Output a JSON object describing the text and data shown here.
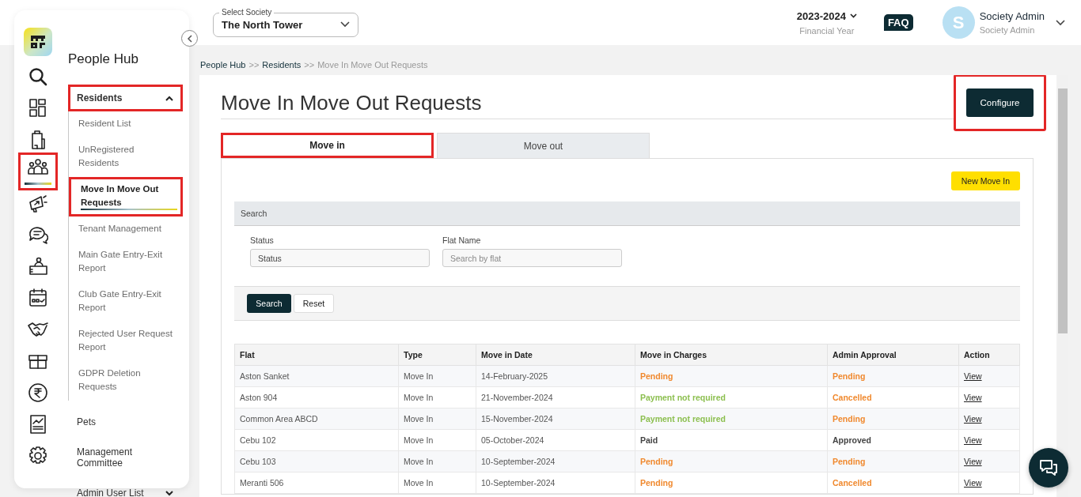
{
  "sidebar": {
    "rail": [
      {
        "kind": "search",
        "selected": false,
        "highlighted": false
      },
      {
        "kind": "dashboard",
        "selected": false,
        "highlighted": false
      },
      {
        "kind": "building",
        "selected": false,
        "highlighted": false
      },
      {
        "kind": "people",
        "selected": true,
        "highlighted": true
      },
      {
        "kind": "megaphone",
        "selected": false,
        "highlighted": false
      },
      {
        "kind": "chat",
        "selected": false,
        "highlighted": false
      },
      {
        "kind": "reception",
        "selected": false,
        "highlighted": false
      },
      {
        "kind": "calendar",
        "selected": false,
        "highlighted": false
      },
      {
        "kind": "handshake",
        "selected": false,
        "highlighted": false
      },
      {
        "kind": "gift",
        "selected": false,
        "highlighted": false
      },
      {
        "kind": "rupee",
        "selected": false,
        "highlighted": false
      },
      {
        "kind": "chart",
        "selected": false,
        "highlighted": false
      },
      {
        "kind": "settings",
        "selected": false,
        "highlighted": false
      }
    ],
    "nav": {
      "title": "People Hub",
      "groups": [
        {
          "label": "Residents",
          "expanded": true,
          "highlighted": true,
          "children": [
            {
              "label": "Resident List",
              "selected": false,
              "highlighted": false
            },
            {
              "label": "UnRegistered Residents",
              "selected": false,
              "highlighted": false
            },
            {
              "label": "Move In Move Out Requests",
              "selected": true,
              "highlighted": true
            },
            {
              "label": "Tenant Management",
              "selected": false,
              "highlighted": false
            },
            {
              "label": "Main Gate Entry-Exit Report",
              "selected": false,
              "highlighted": false
            },
            {
              "label": "Club Gate Entry-Exit Report",
              "selected": false,
              "highlighted": false
            },
            {
              "label": "Rejected User Request Report",
              "selected": false,
              "highlighted": false
            },
            {
              "label": "GDPR Deletion Requests",
              "selected": false,
              "highlighted": false
            }
          ]
        },
        {
          "label": "Pets",
          "highlighted": false
        },
        {
          "label": "Management Committee",
          "highlighted": false
        },
        {
          "label": "Admin User List",
          "expanded": false,
          "highlighted": false
        }
      ]
    }
  },
  "header": {
    "society": {
      "label": "Select Society",
      "value": "The North Tower"
    },
    "year": {
      "value": "2023-2024",
      "caption": "Financial Year"
    },
    "faq": "FAQ",
    "user": {
      "initial": "S",
      "name": "Society Admin",
      "role": "Society Admin"
    }
  },
  "breadcrumb": [
    {
      "kind": "link",
      "label": "People Hub"
    },
    {
      "kind": "separator",
      "label": ">>"
    },
    {
      "kind": "link",
      "label": "Residents"
    },
    {
      "kind": "separator",
      "label": ">>"
    },
    {
      "kind": "current",
      "label": "Move In Move Out Requests"
    }
  ],
  "page": {
    "title": "Move In Move Out Requests",
    "configure": {
      "label": "Configure",
      "highlighted": true
    },
    "tabs": [
      {
        "label": "Move in",
        "selected": true,
        "highlighted": true
      },
      {
        "label": "Move out",
        "selected": false,
        "highlighted": false
      }
    ],
    "new_button": "New Move In",
    "search": {
      "title": "Search",
      "fields": [
        {
          "label": "Status",
          "value": "Status"
        },
        {
          "label": "Flat Name",
          "placeholder": "Search by flat"
        }
      ],
      "buttons": [
        {
          "label": "Search",
          "kind": "primary"
        },
        {
          "label": "Reset",
          "kind": "secondary"
        }
      ]
    },
    "table": {
      "columns": [
        "Flat",
        "Type",
        "Move in Date",
        "Move in Charges",
        "Admin Approval",
        "Action"
      ],
      "rows": [
        {
          "flat": "Aston Sanket",
          "type": "Move In",
          "date": "14-February-2025",
          "charges": {
            "text": "Pending",
            "color": "#f0892e"
          },
          "approval": {
            "text": "Pending",
            "color": "#f0892e"
          },
          "action": "View"
        },
        {
          "flat": "Aston 904",
          "type": "Move In",
          "date": "21-November-2024",
          "charges": {
            "text": "Payment not required",
            "color": "#8cbf4f"
          },
          "approval": {
            "text": "Cancelled",
            "color": "#f0892e"
          },
          "action": "View"
        },
        {
          "flat": "Common Area ABCD",
          "type": "Move In",
          "date": "15-November-2024",
          "charges": {
            "text": "Payment not required",
            "color": "#8cbf4f"
          },
          "approval": {
            "text": "Pending",
            "color": "#f0892e"
          },
          "action": "View"
        },
        {
          "flat": "Cebu 102",
          "type": "Move In",
          "date": "05-October-2024",
          "charges": {
            "text": "Paid",
            "color": "#444444"
          },
          "approval": {
            "text": "Approved",
            "color": "#444444"
          },
          "action": "View"
        },
        {
          "flat": "Cebu 103",
          "type": "Move In",
          "date": "10-September-2024",
          "charges": {
            "text": "Pending",
            "color": "#f0892e"
          },
          "approval": {
            "text": "Pending",
            "color": "#f0892e"
          },
          "action": "View"
        },
        {
          "flat": "Meranti 506",
          "type": "Move In",
          "date": "10-September-2024",
          "charges": {
            "text": "Pending",
            "color": "#f0892e"
          },
          "approval": {
            "text": "Cancelled",
            "color": "#f0892e"
          },
          "action": "View"
        }
      ]
    }
  }
}
